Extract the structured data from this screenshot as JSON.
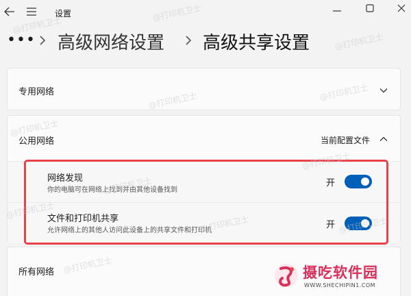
{
  "window": {
    "title": "设置",
    "controls": [
      "back-icon",
      "menu-icon",
      "minimize-icon",
      "maximize-icon",
      "close-icon"
    ]
  },
  "breadcrumb": {
    "more": "•••",
    "items": [
      "高级网络设置",
      "高级共享设置"
    ]
  },
  "sections": {
    "private": {
      "label": "专用网络",
      "expanded": false
    },
    "public": {
      "label": "公用网络",
      "profile_label": "当前配置文件",
      "expanded": true,
      "settings": [
        {
          "title": "网络发现",
          "description": "你的电脑可在网络上找到并由其他设备找到",
          "state": "开",
          "on": true
        },
        {
          "title": "文件和打印机共享",
          "description": "允许网络上的其他人访问此设备上的共享文件和打印机",
          "state": "开",
          "on": true
        }
      ]
    },
    "all": {
      "label": "所有网络"
    }
  },
  "watermark": {
    "text": "@打印机卫士"
  },
  "logo": {
    "text": "摄吃软件园",
    "url": "WWW.SHECHIPIN1.COM"
  },
  "colors": {
    "accent": "#005fb8",
    "highlight": "#e9414a",
    "logo": "#d8305a",
    "background": "#f3f3f3",
    "card": "#fbfbfb"
  }
}
